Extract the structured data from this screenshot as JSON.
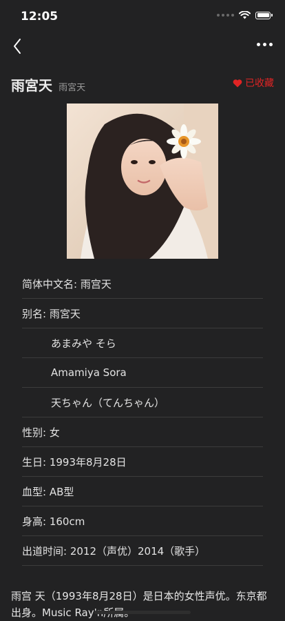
{
  "status": {
    "time": "12:05"
  },
  "header": {
    "title": "雨宮天",
    "subtitle": "雨宮天",
    "favorite_label": "已收藏",
    "accent": "#e02424"
  },
  "info": {
    "rows": [
      "简体中文名: 雨宫天",
      "别名: 雨宮天",
      "あまみや そら",
      "Amamiya Sora",
      "天ちゃん（てんちゃん）",
      "性别: 女",
      "生日: 1993年8月28日",
      "血型: AB型",
      "身高: 160cm",
      "出道时间: 2012（声优）2014（歌手）"
    ]
  },
  "bio": {
    "text": "雨宫 天（1993年8月28日）是日本的女性声优。东京都出身。Music Ray'n所属。"
  }
}
